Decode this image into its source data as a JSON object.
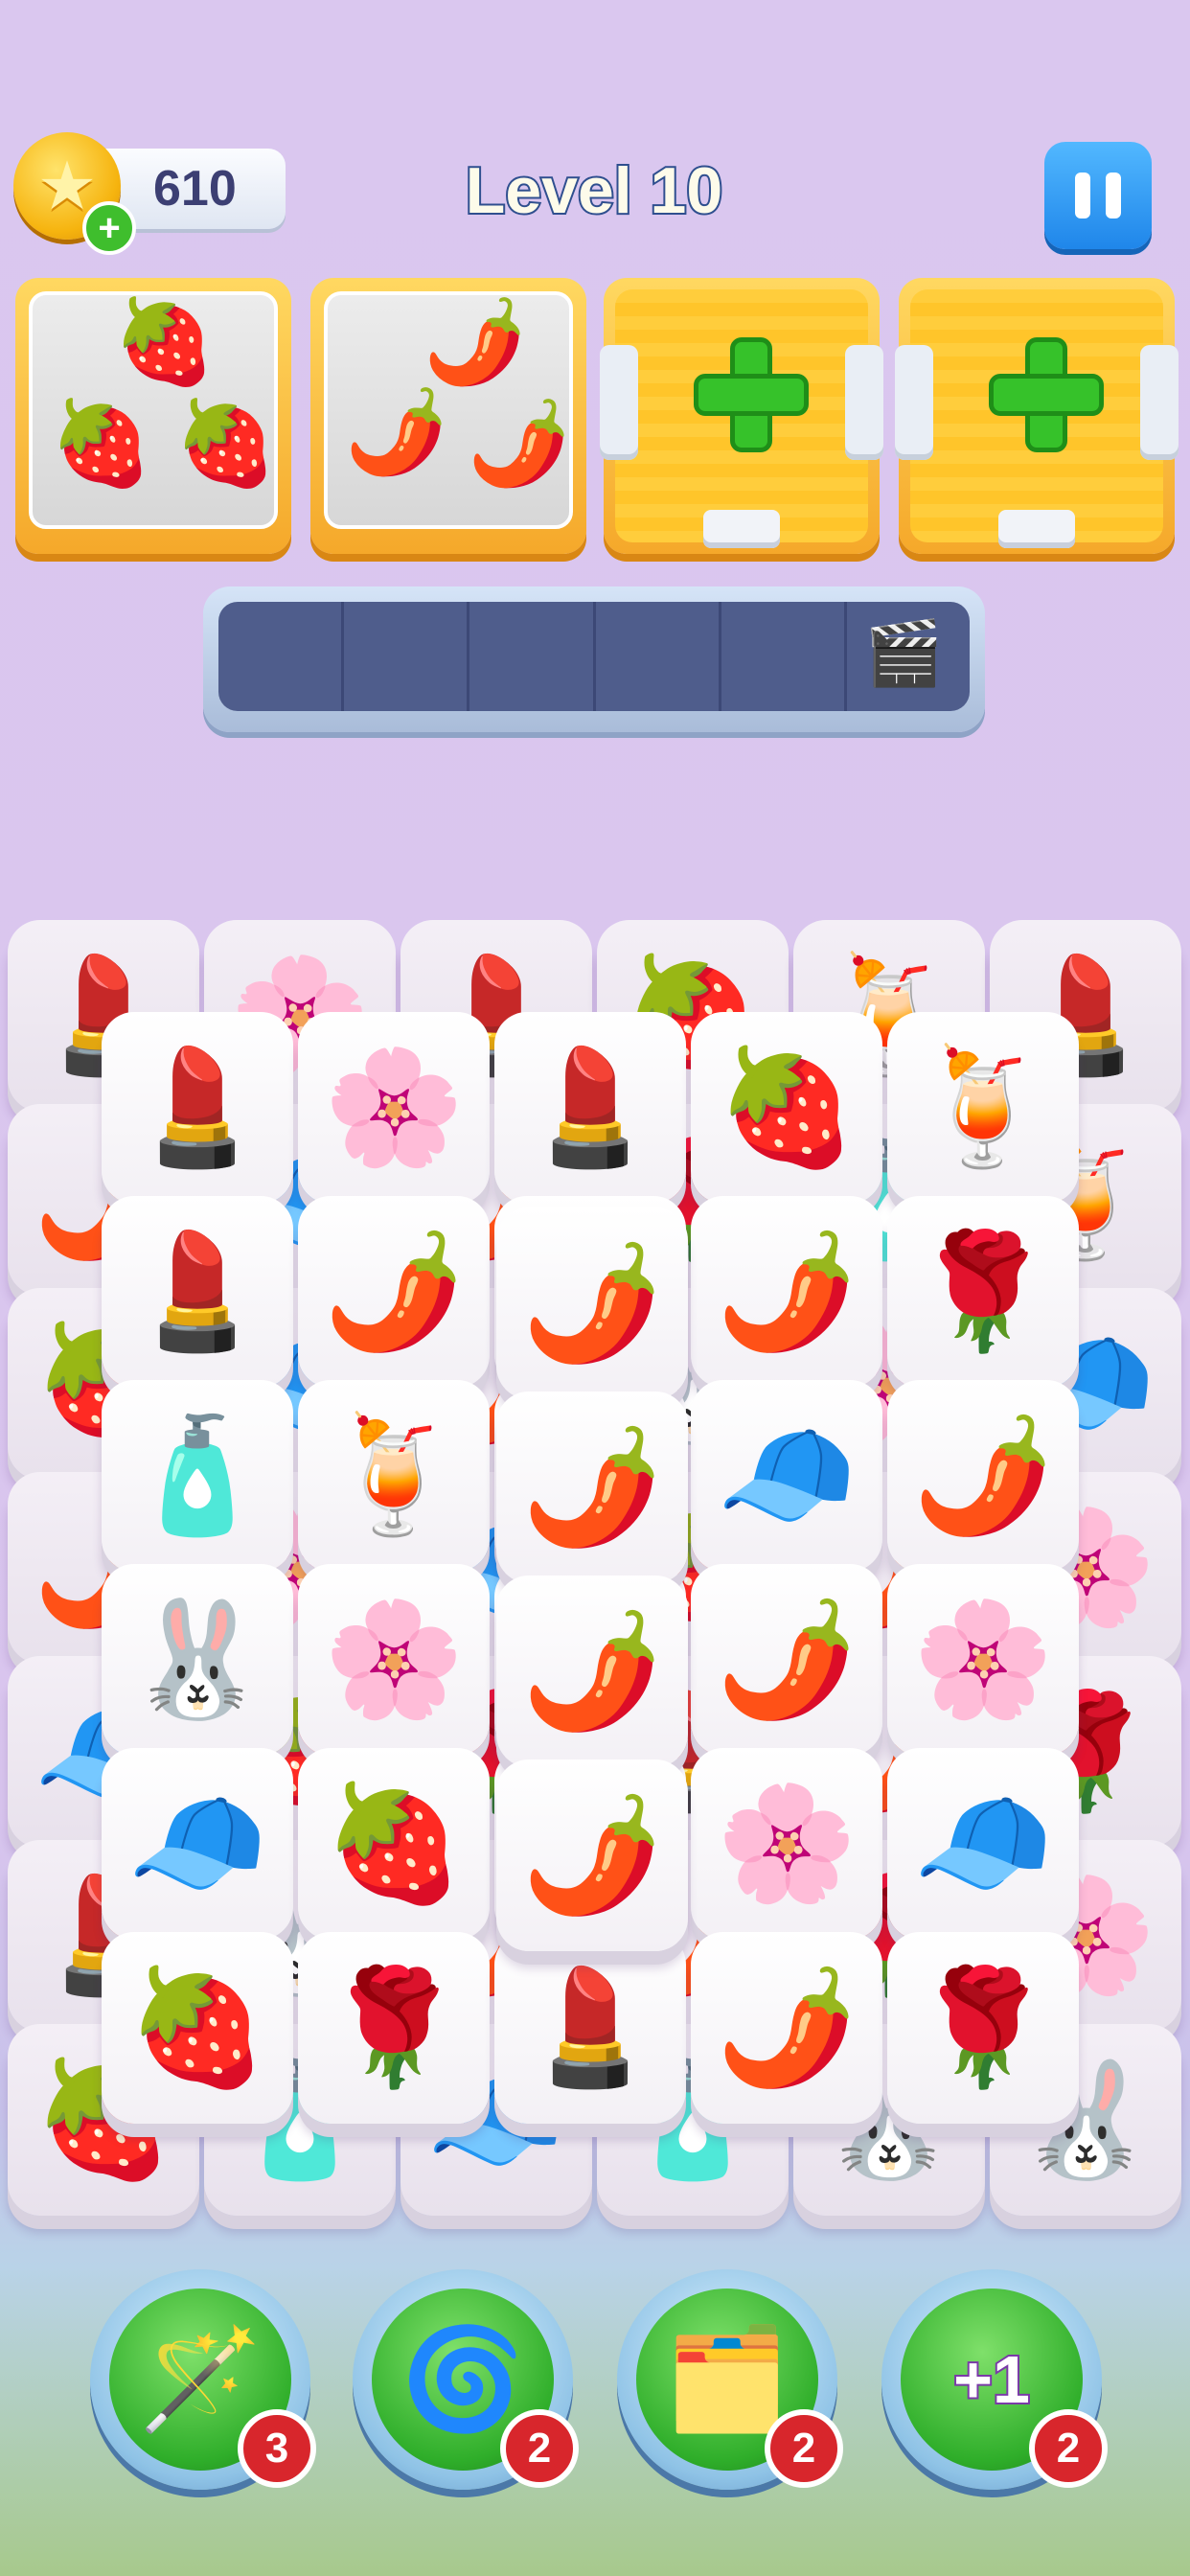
{
  "header": {
    "coins": "610",
    "level_title": "Level 10"
  },
  "icons": {
    "coin": "star-coin-icon",
    "add_coins": "plus-icon",
    "pause": "pause-icon",
    "tray_video": "clapperboard-video-icon"
  },
  "order_slots": [
    {
      "type": "collection",
      "item": "strawberry",
      "glyph": "🍓",
      "count": 3
    },
    {
      "type": "collection",
      "item": "chili-pepper",
      "glyph": "🌶️",
      "count": 3
    },
    {
      "type": "add-slot",
      "icon": "green-plus-icon"
    },
    {
      "type": "add-slot",
      "icon": "green-plus-icon"
    }
  ],
  "tray": {
    "slots": 6
  },
  "board": {
    "tiles": [
      [
        "lipstick",
        "💄"
      ],
      [
        "flower",
        "🌸"
      ],
      [
        "lipstick",
        "💄"
      ],
      [
        "strawberry",
        "🍓"
      ],
      [
        "drink",
        "🍹"
      ],
      [
        "lipstick",
        "💄"
      ],
      [
        "pepper",
        "🌶️"
      ],
      [
        "cap",
        "🧢"
      ],
      [
        "pepper",
        "🌶️"
      ],
      [
        "rose",
        "🌹"
      ],
      [
        "lotion",
        "🧴"
      ],
      [
        "drink",
        "🍹"
      ],
      [
        "strawberry",
        "🍓"
      ],
      [
        "cap",
        "🧢"
      ],
      [
        "pepper",
        "🌶️"
      ],
      [
        "bunny",
        "🐰"
      ],
      [
        "flower",
        "🌸"
      ],
      [
        "cap",
        "🧢"
      ],
      [
        "pepper",
        "🌶️"
      ],
      [
        "flower",
        "🌸"
      ],
      [
        "cap",
        "🧢"
      ],
      [
        "strawberry",
        "🍓"
      ],
      [
        "pepper",
        "🌶️"
      ],
      [
        "flower",
        "🌸"
      ],
      [
        "cap",
        "🧢"
      ],
      [
        "strawberry",
        "🍓"
      ],
      [
        "rose",
        "🌹"
      ],
      [
        "lipstick",
        "💄"
      ],
      [
        "pepper",
        "🌶️"
      ],
      [
        "rose",
        "🌹"
      ],
      [
        "lipstick",
        "💄"
      ],
      [
        "bunny",
        "🐰"
      ],
      [
        "pepper",
        "🌶️"
      ],
      [
        "pepper",
        "🌶️"
      ],
      [
        "rose",
        "🌹"
      ],
      [
        "flower",
        "🌸"
      ],
      [
        "strawberry",
        "🍓"
      ],
      [
        "lotion",
        "🧴"
      ],
      [
        "cap",
        "🧢"
      ],
      [
        "lotion",
        "🧴"
      ],
      [
        "bunny",
        "🐰"
      ],
      [
        "bunny",
        "🐰"
      ]
    ]
  },
  "boosters": [
    {
      "name": "magic-wand",
      "glyph": "🪄",
      "count": "3"
    },
    {
      "name": "pinwheel-shuffle",
      "glyph": "🌀",
      "count": "2"
    },
    {
      "name": "undo-cards",
      "glyph": "🗂️",
      "count": "2"
    },
    {
      "name": "plus-one-slot",
      "label": "+1",
      "count": "2"
    }
  ],
  "colors": {
    "background": "#dac7ef",
    "accent_blue": "#1f86ea",
    "order_yellow": "#f5a82a",
    "badge_red": "#d8262c",
    "booster_green": "#2fae2a"
  }
}
